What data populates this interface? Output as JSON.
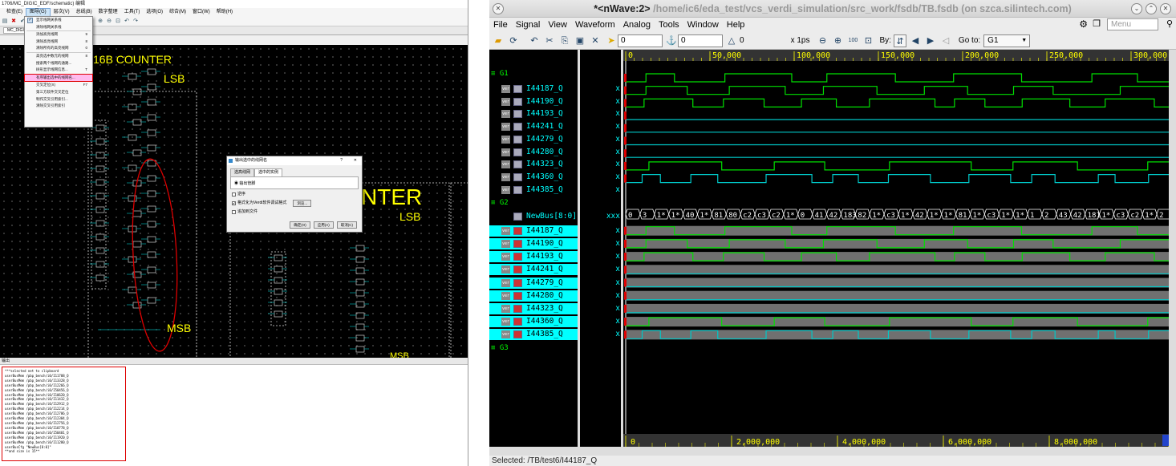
{
  "left_window": {
    "title": "1706/MC_DIGIC_EDF/schematic) 编辑",
    "menu": [
      "检查(E)",
      "图导(G)",
      "层次(V)",
      "总线(B)",
      "数字整理",
      "工具(T)",
      "选项(O)",
      "综合(M)",
      "窗口(W)",
      "帮助(H)"
    ],
    "active_menu": "图导(G)",
    "tab": "MC_DIGIC",
    "dropdown": [
      {
        "label": "显示线网关系线",
        "shortcut": "",
        "checked": true
      },
      {
        "label": "清除线网关系线",
        "shortcut": ""
      },
      {
        "sep": true
      },
      {
        "label": "添加高亮线网",
        "shortcut": "9"
      },
      {
        "label": "清除高亮线网",
        "shortcut": "8"
      },
      {
        "label": "清除所有的高亮线网",
        "shortcut": "0"
      },
      {
        "sep": true
      },
      {
        "label": "高亮选中数元的线网",
        "shortcut": "8"
      },
      {
        "label": "搜索两个线网的通路...",
        "shortcut": ""
      },
      {
        "label": "树形显示线网信息...",
        "shortcut": "T"
      },
      {
        "sep": true
      },
      {
        "label": "有序输出选中的线网名...",
        "shortcut": "",
        "highlight": true
      },
      {
        "sep": true
      },
      {
        "label": "交叉定位(X)",
        "shortcut": "F7"
      },
      {
        "label": "第三方软件交叉定位",
        "shortcut": ""
      },
      {
        "label": "制作交叉引用索引...",
        "shortcut": ""
      },
      {
        "label": "清除交叉引用索引",
        "shortcut": ""
      }
    ],
    "schematic": {
      "title1": "16B COUNTER",
      "lsb1": "LSB",
      "msb1": "MSB",
      "title2": "NTER",
      "lsb2": "LSB",
      "msb2": "MSB"
    },
    "dialog": {
      "title": "输出选中的线网名",
      "help": "?",
      "close": "✕",
      "tabs": [
        "选高线网",
        "选中的实例"
      ],
      "radio_label": "输出管脚",
      "options": [
        {
          "label": "逆序",
          "checked": false
        },
        {
          "label": "格式化为Verdi软件调试格式",
          "checked": true
        },
        {
          "label": "追加到文件",
          "checked": false
        }
      ],
      "browse": "浏览...",
      "buttons": [
        "确定(O)",
        "应用(A)",
        "取消(C)"
      ]
    },
    "output_header": "输出",
    "output_lines": [
      "***selected net to clipboard",
      "userBusMem /pbp_bench/i0/I11788_Q",
      "userBusMem /pbp_bench/i0/I13328_Q",
      "userBusMem /pbp_bench/i0/I12266_Q",
      "userBusMem /pbp_bench/i0/I50456_Q",
      "userBusMem /pbp_bench/i0/I10620_Q",
      "userBusMem /pbp_bench/i0/I11432_Q",
      "userBusMem /pbp_bench/i0/I12912_Q",
      "userBusMem /pbp_bench/i0/I12214_Q",
      "userBusMem /pbp_bench/i0/I12786_Q",
      "userBusMem /pbp_bench/i0/I12304_Q",
      "userBusMem /pbp_bench/i0/I12756_Q",
      "userBusMem /pbp_bench/i0/I10778_Q",
      "userBusMem /pbp_bench/i0/I50401_Q",
      "userBusMem /pbp_bench/i0/I11920_Q",
      "userBusMem /pbp_bench/i0/I11280_Q",
      "userBusCfg \"NewBus[8:0]\"",
      "**and size is 15**"
    ]
  },
  "right_window": {
    "title_main": "*<nWave:2>",
    "title_sub": "/home/ic6/eda_test/vcs_verdi_simulation/src_work/fsdb/TB.fsdb (on szca.silintech.com)",
    "menu": [
      "File",
      "Signal",
      "View",
      "Waveform",
      "Analog",
      "Tools",
      "Window",
      "Help"
    ],
    "menu_search_placeholder": "Menu",
    "toolbar": {
      "cursor_value": "0",
      "marker_value": "0",
      "delta_value": "0",
      "time_unit": "x 1ps",
      "by_label": "By:",
      "goto_label": "Go to:",
      "goto_value": "G1"
    },
    "groups": [
      "G1",
      "G2",
      "G3"
    ],
    "g1_signals": [
      "I44187_Q",
      "I44190_Q",
      "I44193_Q",
      "I44241_Q",
      "I44279_Q",
      "I44280_Q",
      "I44323_Q",
      "I44360_Q",
      "I44385_Q"
    ],
    "bus_name": "NewBus[8:0]",
    "bus_value": "xxx",
    "g2_signals": [
      "I44187_Q",
      "I44190_Q",
      "I44193_Q",
      "I44241_Q",
      "I44279_Q",
      "I44280_Q",
      "I44323_Q",
      "I44360_Q",
      "I44385_Q"
    ],
    "signal_value": "x",
    "ruler_top": [
      "0",
      "50,000",
      "100,000",
      "150,000",
      "200,000",
      "250,000",
      "300,000"
    ],
    "ruler_bottom": [
      "0",
      "2,000,000",
      "4,000,000",
      "6,000,000",
      "8,000,000"
    ],
    "bus_segments": [
      "0",
      "3",
      "1*",
      "1*",
      "40",
      "1*",
      "81",
      "80",
      "c2",
      "c3",
      "c2",
      "1*",
      "0",
      "41",
      "42",
      "183",
      "82",
      "1*",
      "c3",
      "1*",
      "42",
      "1*",
      "1*",
      "81",
      "1*",
      "c3",
      "1*",
      "1*",
      "1",
      "2",
      "43",
      "42",
      "181",
      "1*",
      "c3",
      "c2",
      "1*",
      "2"
    ],
    "status": "Selected: /TB/test6/I44187_Q",
    "colors": {
      "wave_green": "#00e000",
      "wave_cyan": "#00c8c8",
      "select": "#00ffff"
    }
  }
}
